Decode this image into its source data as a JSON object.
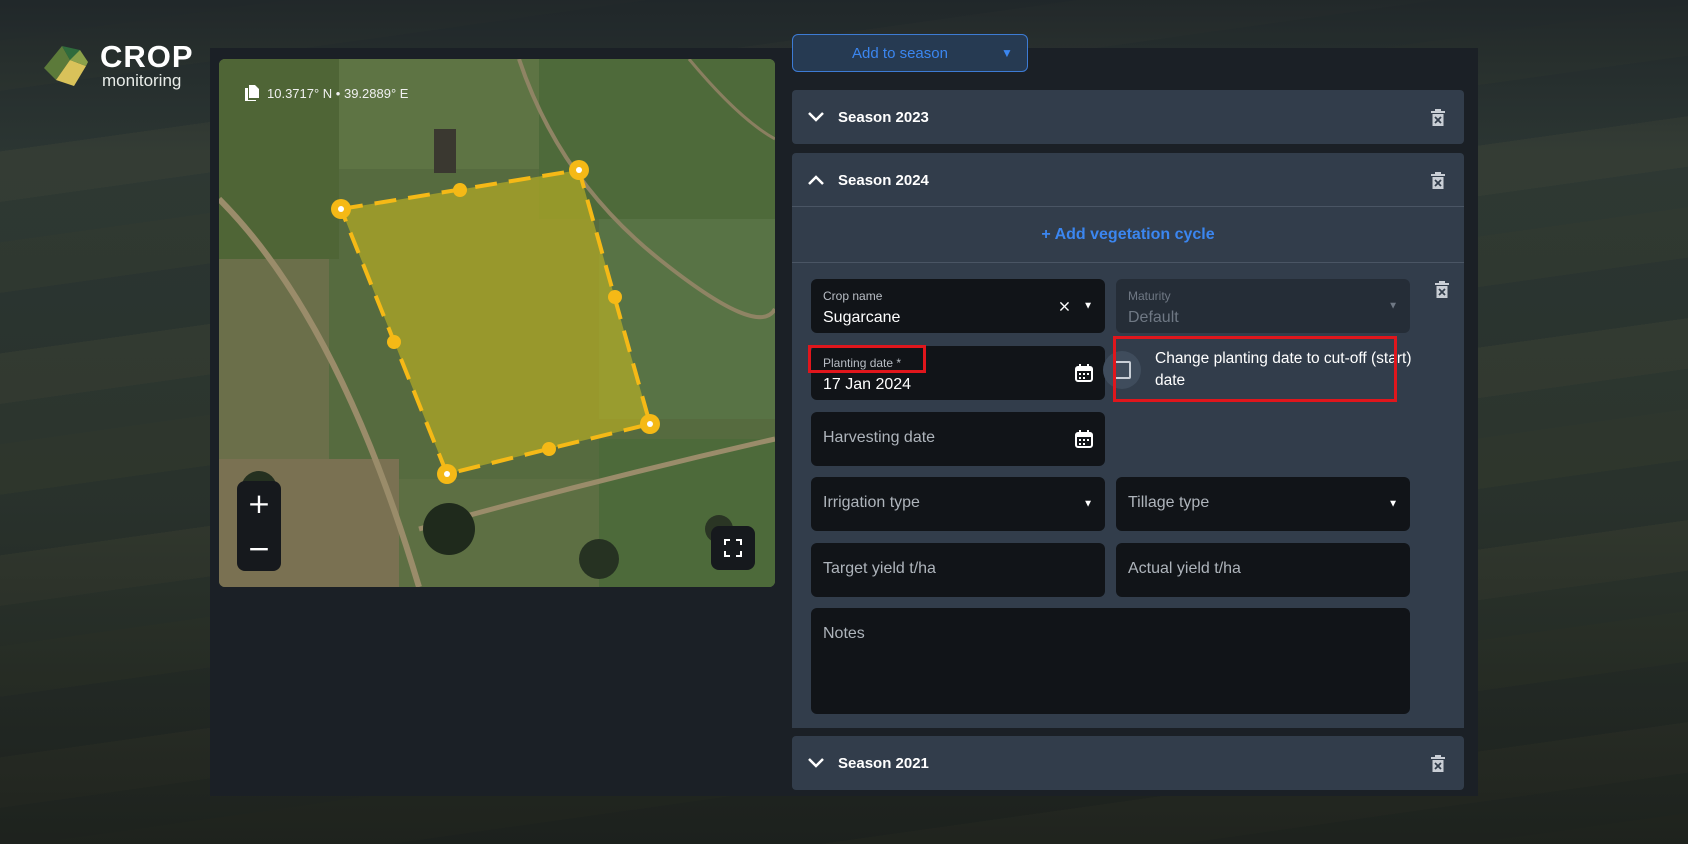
{
  "brand": {
    "name": "CROP",
    "sub": "monitoring"
  },
  "map": {
    "coordinates": "10.3717° N • 39.2889° E",
    "zoom_in": "+",
    "zoom_out": "−",
    "icons": {
      "copy": "copy-icon",
      "fullscreen": "fullscreen-icon"
    }
  },
  "actions": {
    "add_to_season": "Add to season"
  },
  "seasons": [
    {
      "title": "Season 2023",
      "expanded": false
    },
    {
      "title": "Season 2024",
      "expanded": true
    },
    {
      "title": "Season 2021",
      "expanded": false
    }
  ],
  "season_2024": {
    "add_vegetation_cycle": "+ Add vegetation cycle",
    "crop_name": {
      "label": "Crop name",
      "value": "Sugarcane"
    },
    "maturity": {
      "label": "Maturity",
      "value": "Default"
    },
    "planting_date": {
      "label": "Planting date *",
      "value": "17 Jan 2024"
    },
    "cutoff_checkbox": {
      "label": "Change planting date to cut-off (start) date",
      "checked": false
    },
    "harvesting_date": {
      "placeholder": "Harvesting date"
    },
    "irrigation_type": {
      "placeholder": "Irrigation type"
    },
    "tillage_type": {
      "placeholder": "Tillage type"
    },
    "target_yield": {
      "placeholder": "Target yield t/ha"
    },
    "actual_yield": {
      "placeholder": "Actual yield t/ha"
    },
    "notes": {
      "placeholder": "Notes"
    }
  },
  "colors": {
    "accent": "#3b86f0",
    "field_polygon": "#f5b916",
    "highlight": "#e0161c",
    "panel": "#1b2026",
    "section": "#323d4b"
  }
}
